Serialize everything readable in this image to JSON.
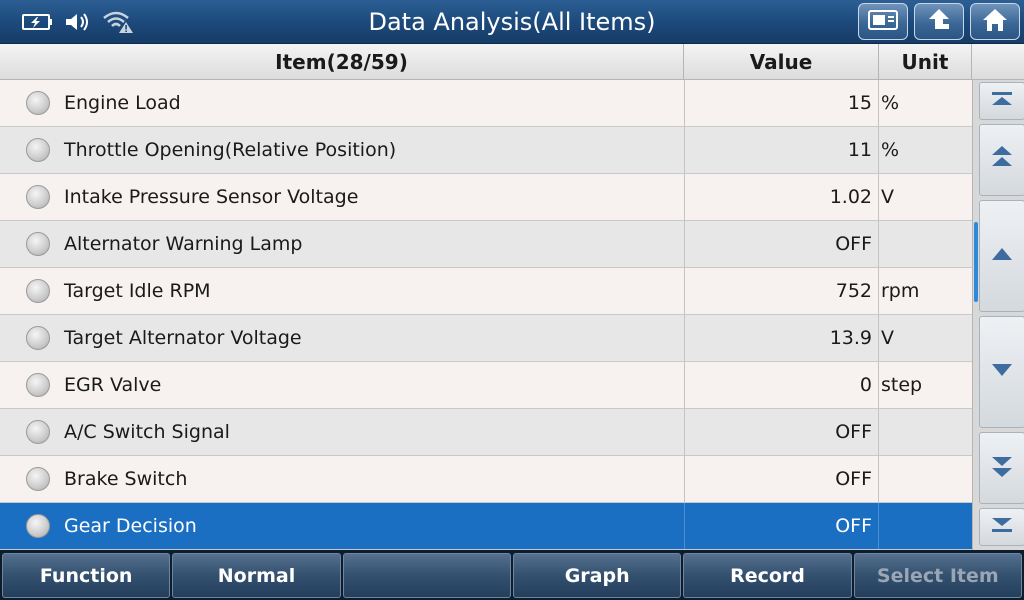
{
  "header": {
    "title": "Data Analysis(All Items)",
    "status_icons": [
      "battery-charging-icon",
      "speaker-icon",
      "wifi-warning-icon"
    ],
    "nav_buttons": [
      "screenshot-icon",
      "back-arrow-icon",
      "home-icon"
    ]
  },
  "table": {
    "columns": {
      "item": "Item(28/59)",
      "value": "Value",
      "unit": "Unit"
    },
    "rows": [
      {
        "name": "Engine Load",
        "value": "15",
        "unit": "%"
      },
      {
        "name": "Throttle Opening(Relative Position)",
        "value": "11",
        "unit": "%"
      },
      {
        "name": "Intake Pressure Sensor Voltage",
        "value": "1.02",
        "unit": "V"
      },
      {
        "name": "Alternator Warning Lamp",
        "value": "OFF",
        "unit": ""
      },
      {
        "name": "Target Idle RPM",
        "value": "752",
        "unit": "rpm"
      },
      {
        "name": "Target Alternator Voltage",
        "value": "13.9",
        "unit": "V"
      },
      {
        "name": "EGR Valve",
        "value": "0",
        "unit": "step"
      },
      {
        "name": "A/C Switch Signal",
        "value": "OFF",
        "unit": ""
      },
      {
        "name": "Brake Switch",
        "value": "OFF",
        "unit": ""
      },
      {
        "name": "Gear Decision",
        "value": "OFF",
        "unit": ""
      }
    ],
    "selected_index": 9
  },
  "scroll_buttons": [
    "scroll-top-icon",
    "page-up-icon",
    "line-up-icon",
    "line-down-icon",
    "page-down-icon",
    "scroll-bottom-icon"
  ],
  "toolbar": {
    "function_label": "Function",
    "normal_label": "Normal",
    "blank_label": "",
    "graph_label": "Graph",
    "record_label": "Record",
    "select_item_label": "Select Item"
  },
  "colors": {
    "title_bar": "#1d4a7c",
    "selected_row": "#1a6fc2",
    "toolbar": "#33506f"
  }
}
